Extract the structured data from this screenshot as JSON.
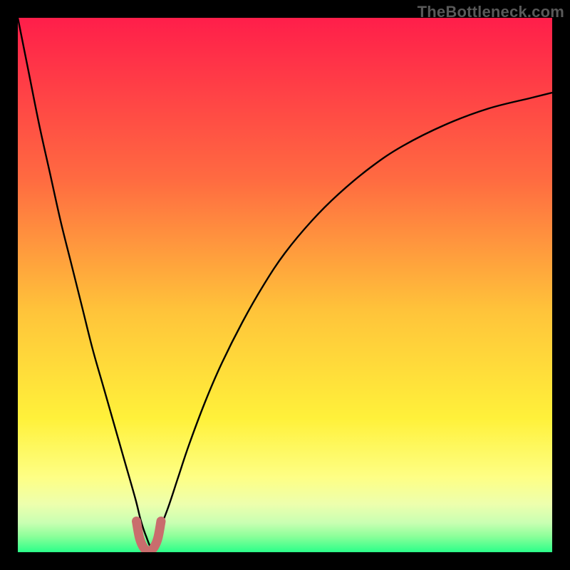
{
  "watermark": "TheBottleneck.com",
  "chart_data": {
    "type": "line",
    "title": "",
    "xlabel": "",
    "ylabel": "",
    "xlim": [
      0,
      100
    ],
    "ylim": [
      0,
      100
    ],
    "grid": false,
    "legend": false,
    "background_gradient": {
      "stops": [
        {
          "offset": 0.0,
          "color": "#ff1e4a"
        },
        {
          "offset": 0.3,
          "color": "#ff6a41"
        },
        {
          "offset": 0.55,
          "color": "#ffc43a"
        },
        {
          "offset": 0.75,
          "color": "#fff13a"
        },
        {
          "offset": 0.86,
          "color": "#feff85"
        },
        {
          "offset": 0.91,
          "color": "#edffad"
        },
        {
          "offset": 0.945,
          "color": "#c9ffb2"
        },
        {
          "offset": 0.97,
          "color": "#8dff9a"
        },
        {
          "offset": 1.0,
          "color": "#2bff89"
        }
      ]
    },
    "series": [
      {
        "name": "bottleneck-curve",
        "stroke": "#000000",
        "stroke_width": 2.4,
        "x": [
          0,
          2,
          4,
          6,
          8,
          10,
          12,
          14,
          16,
          18,
          20,
          22,
          23,
          24,
          25,
          26,
          28,
          30,
          32,
          35,
          38,
          42,
          46,
          50,
          55,
          60,
          66,
          72,
          80,
          88,
          96,
          100
        ],
        "y": [
          100,
          90,
          80,
          71,
          62,
          54,
          46,
          38,
          31,
          24,
          17,
          10,
          6,
          3,
          1,
          3,
          8,
          14,
          20,
          28,
          35,
          43,
          50,
          56,
          62,
          67,
          72,
          76,
          80,
          83,
          85,
          86
        ]
      },
      {
        "name": "sweet-spot-marker",
        "stroke": "#c96d6d",
        "stroke_width": 13,
        "linecap": "round",
        "x": [
          22.2,
          22.8,
          23.6,
          24.5,
          25.4,
          26.2,
          26.8
        ],
        "y": [
          5.8,
          2.6,
          0.8,
          0.2,
          0.8,
          2.6,
          5.8
        ]
      }
    ]
  }
}
